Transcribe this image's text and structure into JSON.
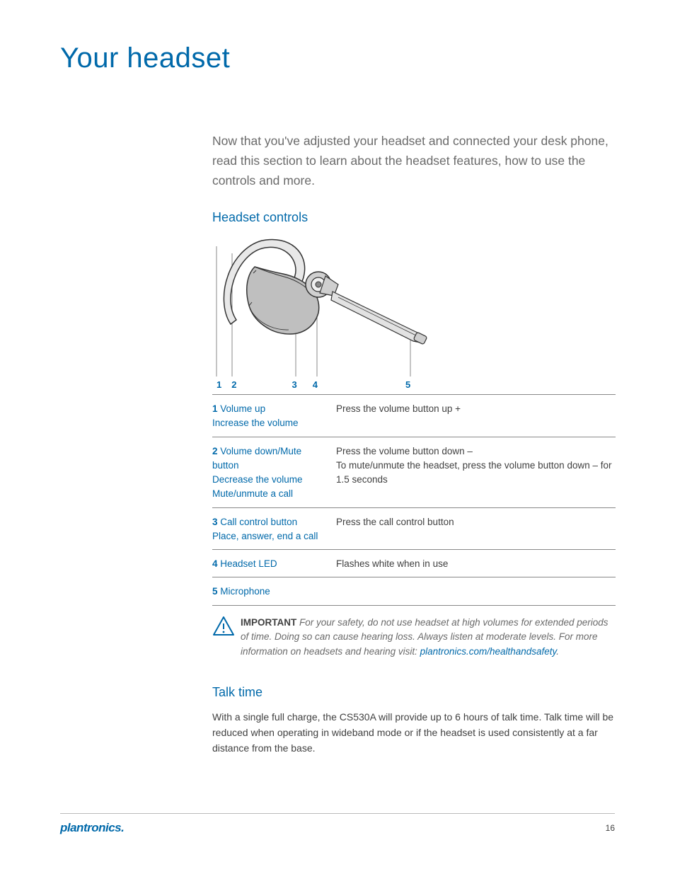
{
  "title": "Your headset",
  "intro": "Now that you've adjusted your headset and connected your desk phone, read this section to learn about the headset features, how to use the controls and more.",
  "section_controls": "Headset controls",
  "callouts": [
    "1",
    "2",
    "3",
    "4",
    "5"
  ],
  "rows": [
    {
      "num": "1",
      "label": "Volume up",
      "subs": [
        "Increase the volume"
      ],
      "right": "Press the volume button up +"
    },
    {
      "num": "2",
      "label": "Volume down/Mute button",
      "subs": [
        "Decrease the volume",
        "Mute/unmute a call"
      ],
      "right": "Press the volume button down –\nTo mute/unmute the headset, press the volume button down – for 1.5 seconds"
    },
    {
      "num": "3",
      "label": "Call control button",
      "subs": [
        "Place, answer, end a call"
      ],
      "right": "Press the call control button"
    },
    {
      "num": "4",
      "label": "Headset LED",
      "subs": [],
      "right": "Flashes white when in use"
    },
    {
      "num": "5",
      "label": "Microphone",
      "subs": [],
      "right": ""
    }
  ],
  "important": {
    "lead": "IMPORTANT",
    "body_a": "For your safety, do not use headset at high volumes for extended periods of time. Doing so can cause hearing loss. Always listen at moderate levels. For more information on headsets and hearing visit: ",
    "link": "plantronics.com/healthandsafety",
    "body_b": "."
  },
  "talk": {
    "heading": "Talk time",
    "body": "With a single full charge, the CS530A will provide up to 6 hours of talk time. Talk time will be reduced when operating in wideband mode or if the headset is used consistently at a far distance from the base."
  },
  "footer": {
    "brand": "plantronics.",
    "page": "16"
  }
}
